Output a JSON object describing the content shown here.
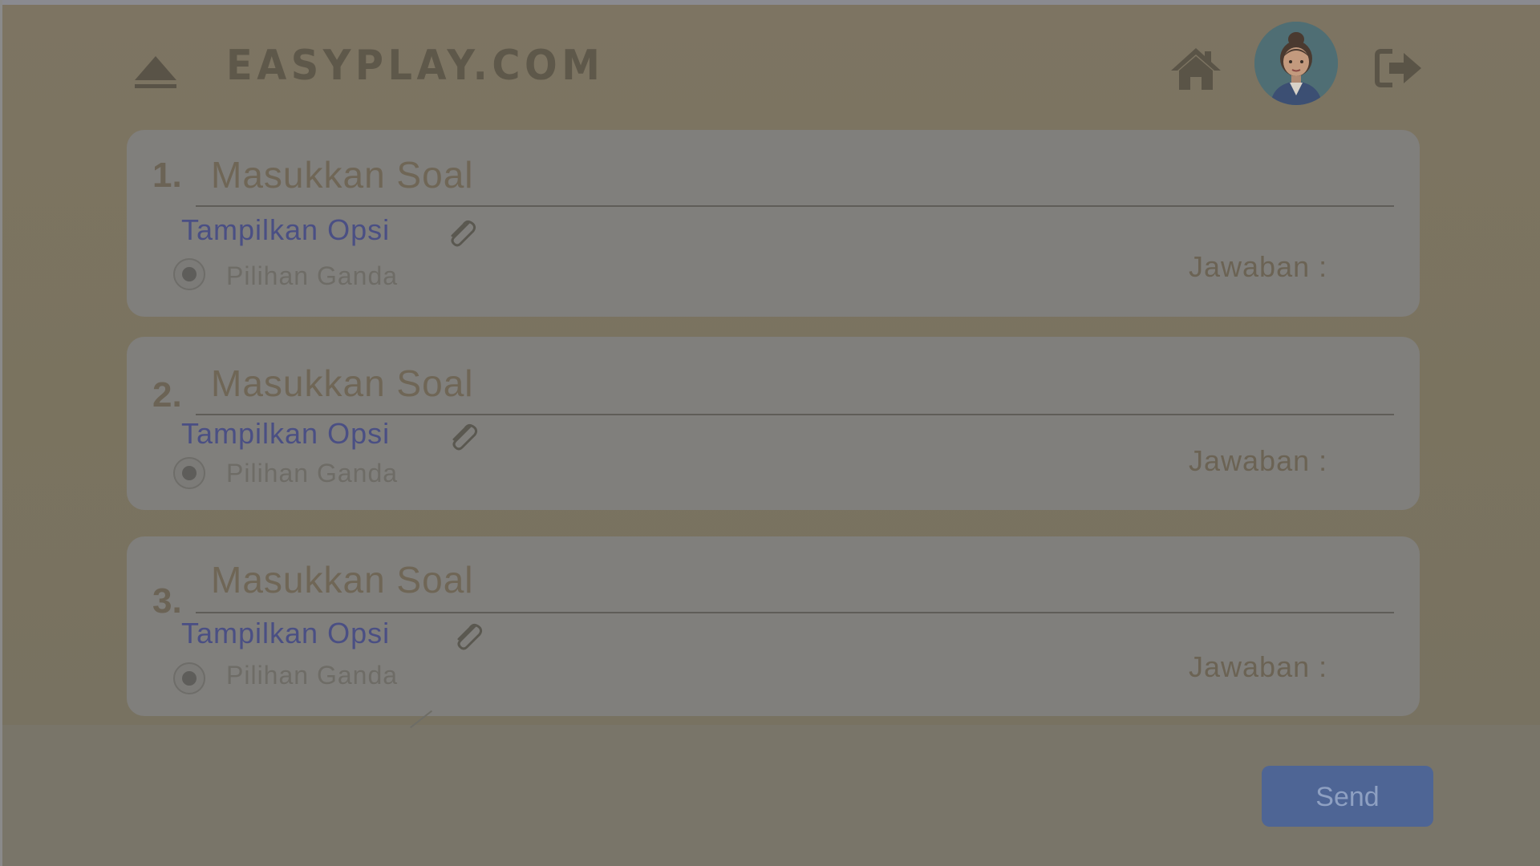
{
  "header": {
    "logo_text": "EASYPLAY.COM",
    "icons": [
      "eject-icon",
      "home-icon",
      "avatar",
      "logout-icon"
    ]
  },
  "questions": [
    {
      "number": "1.",
      "placeholder": "Masukkan Soal",
      "option_label": "Tampilkan Opsi",
      "type_label": "Pilihan Ganda",
      "answer_label": "Jawaban :"
    },
    {
      "number": "2.",
      "placeholder": "Masukkan Soal",
      "option_label": "Tampilkan Opsi",
      "type_label": "Pilihan Ganda",
      "answer_label": "Jawaban :"
    },
    {
      "number": "3.",
      "placeholder": "Masukkan Soal",
      "option_label": "Tampilkan Opsi",
      "type_label": "Pilihan Ganda",
      "answer_label": "Jawaban :"
    }
  ],
  "footer": {
    "send_label": "Send"
  },
  "colors": {
    "background": "#797468",
    "card": "#807f7c",
    "option_link": "#4a4f84",
    "send_button": "#4e6595"
  }
}
